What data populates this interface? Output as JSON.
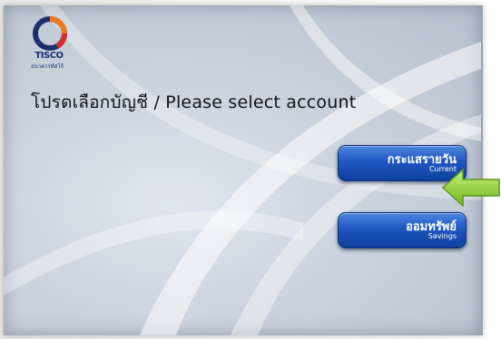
{
  "bank": {
    "logo_text": "TISCO",
    "logo_subtext": "ธนาคารทิสโก้",
    "colors": {
      "ring_blue": "#1b2f6e",
      "ring_orange": "#f07a1a",
      "ring_red": "#d72a2a"
    }
  },
  "screen": {
    "title": "โปรดเลือกบัญชี / Please select account"
  },
  "accounts": [
    {
      "label_th": "กระแสรายวัน",
      "label_en": "Current",
      "highlighted": true
    },
    {
      "label_th": "ออมทรัพย์",
      "label_en": "Savings",
      "highlighted": false
    }
  ],
  "indicator": {
    "icon": "arrow-left-icon",
    "color": "#9bd43a"
  },
  "colors": {
    "button_blue": "#1f57c0",
    "screen_bg": "#c9d2dd"
  }
}
